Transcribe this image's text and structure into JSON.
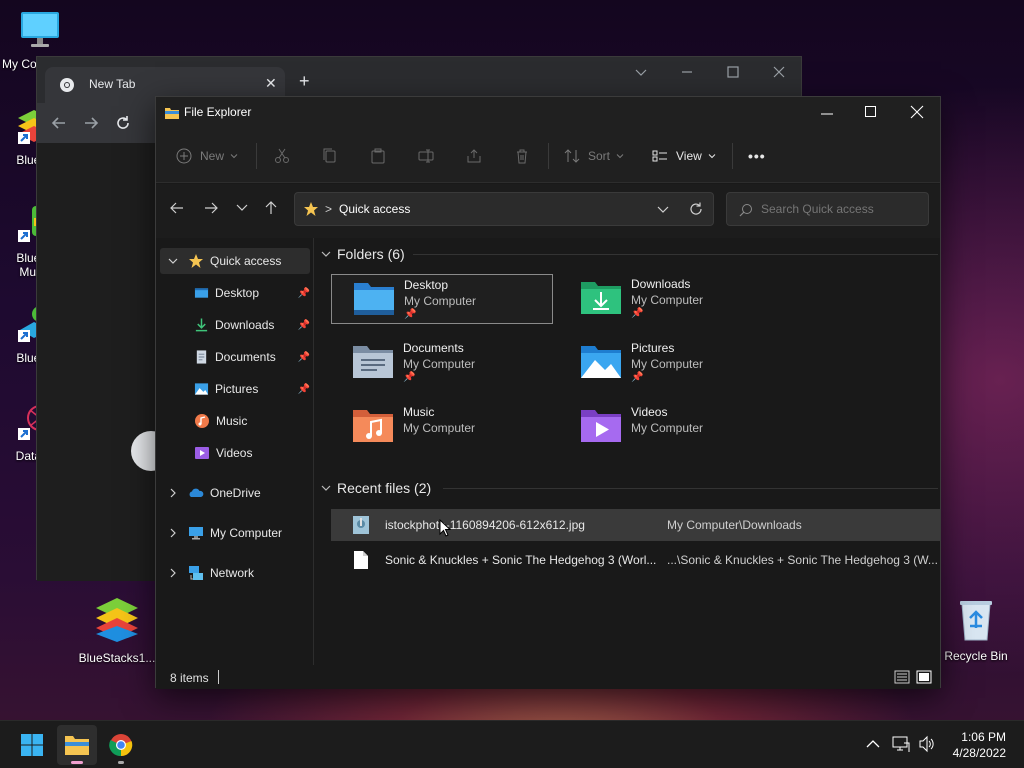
{
  "desktop": {
    "icons": [
      {
        "label": "My Co"
      },
      {
        "label": "BlueSt"
      },
      {
        "label": "BlueSt\nMulti-"
      },
      {
        "label": "BlueSt"
      },
      {
        "label": "DataW"
      },
      {
        "label": "BlueStacks1..."
      },
      {
        "label": "Recycle Bin"
      }
    ]
  },
  "chrome": {
    "tab_title": "New Tab",
    "new_tab_symbol": "+"
  },
  "explorer": {
    "title": "File Explorer",
    "commands": {
      "new_label": "New",
      "sort_label": "Sort",
      "view_label": "View",
      "more_label": "•••"
    },
    "address": {
      "separator": ">",
      "location": "Quick access"
    },
    "search": {
      "placeholder": "Search Quick access"
    },
    "sidebar": {
      "quick_access": "Quick access",
      "items": [
        {
          "label": "Desktop",
          "pinned": true
        },
        {
          "label": "Downloads",
          "pinned": true
        },
        {
          "label": "Documents",
          "pinned": true
        },
        {
          "label": "Pictures",
          "pinned": true
        },
        {
          "label": "Music",
          "pinned": false
        },
        {
          "label": "Videos",
          "pinned": false
        }
      ],
      "roots": [
        {
          "label": "OneDrive"
        },
        {
          "label": "My Computer"
        },
        {
          "label": "Network"
        }
      ]
    },
    "folders": {
      "header": "Folders (6)",
      "items": [
        {
          "name": "Desktop",
          "location": "My Computer",
          "pinned": true
        },
        {
          "name": "Downloads",
          "location": "My Computer",
          "pinned": true
        },
        {
          "name": "Documents",
          "location": "My Computer",
          "pinned": true
        },
        {
          "name": "Pictures",
          "location": "My Computer",
          "pinned": true
        },
        {
          "name": "Music",
          "location": "My Computer",
          "pinned": false
        },
        {
          "name": "Videos",
          "location": "My Computer",
          "pinned": false
        }
      ]
    },
    "recent": {
      "header": "Recent files (2)",
      "items": [
        {
          "name": "istockphoto-1160894206-612x612.jpg",
          "path": "My Computer\\Downloads"
        },
        {
          "name": "Sonic & Knuckles + Sonic The Hedgehog 3 (Worl...",
          "path": "...\\Sonic & Knuckles + Sonic The Hedgehog 3 (W..."
        }
      ]
    },
    "status": {
      "items_count": "8 items"
    }
  },
  "taskbar": {
    "time": "1:06 PM",
    "date": "4/28/2022"
  },
  "colors": {
    "accent": "#0078d4",
    "folder_yellow": "#f5c451",
    "explorer_bg": "#191919"
  }
}
